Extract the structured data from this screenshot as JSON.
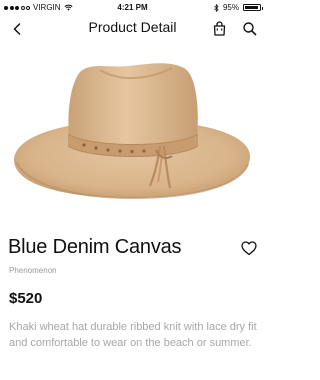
{
  "status_bar": {
    "carrier": "VIRGIN",
    "time": "4:21 PM",
    "battery_percent": "95%",
    "battery_level": 0.95,
    "icons": [
      "signal-dots-icon",
      "wifi-icon",
      "bluetooth-icon",
      "battery-icon"
    ]
  },
  "nav": {
    "title": "Product Detail",
    "back_icon": "chevron-left-icon",
    "bag_icon": "shopping-bag-icon",
    "search_icon": "search-icon"
  },
  "product": {
    "image": "tan-wide-brim-fedora-hat",
    "name": "Blue Denim Canvas",
    "brand": "Phenomenon",
    "price": "$520",
    "description": "Khaki wheat hat durable ribbed knit with lace dry fit and comfortable to wear on the beach or summer.",
    "favorite_icon": "heart-outline-icon"
  },
  "colors": {
    "text": "#111111",
    "muted": "#9a9a9a",
    "description": "#a7a7a7",
    "hat": "#d9b48a"
  }
}
